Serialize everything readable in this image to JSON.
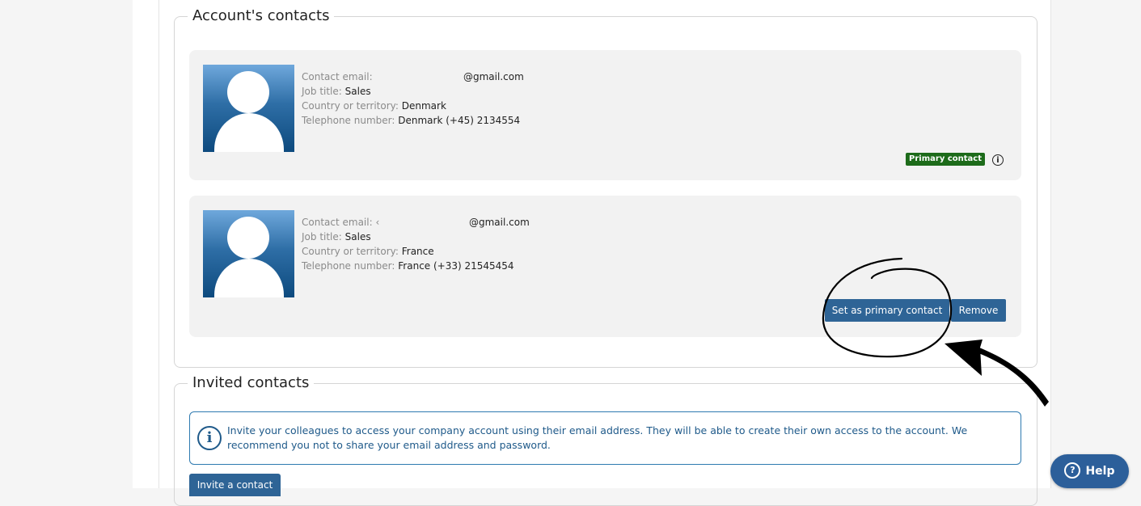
{
  "sections": {
    "accounts_contacts": "Account's contacts",
    "invited_contacts": "Invited contacts"
  },
  "contacts": [
    {
      "email_label": "Contact email:",
      "email_value": "@gmail.com",
      "job_label": "Job title:",
      "job_value": "Sales",
      "country_label": "Country or territory:",
      "country_value": "Denmark",
      "phone_label": "Telephone number:",
      "phone_value": "Denmark (+45) 2134554",
      "badge": "Primary contact",
      "info_icon": "info-circle-icon"
    },
    {
      "email_label": "Contact email: ‹",
      "email_value": "@gmail.com",
      "job_label": "Job title:",
      "job_value": "Sales",
      "country_label": "Country or territory:",
      "country_value": "France",
      "phone_label": "Telephone number:",
      "phone_value": "France (+33) 21545454",
      "set_primary_label": "Set as primary contact",
      "remove_label": "Remove"
    }
  ],
  "invited": {
    "notice_text": "Invite your colleagues to access your company account using their email address. They will be able to create their own access to the account. We recommend you not to share your email address and password.",
    "invite_button": "Invite a contact"
  },
  "help_label": "Help",
  "colors": {
    "primary_button": "#2e6496",
    "badge_green": "#1d6b1a",
    "notice_blue": "#1f5a8a",
    "help_button": "#2c5f9a"
  }
}
